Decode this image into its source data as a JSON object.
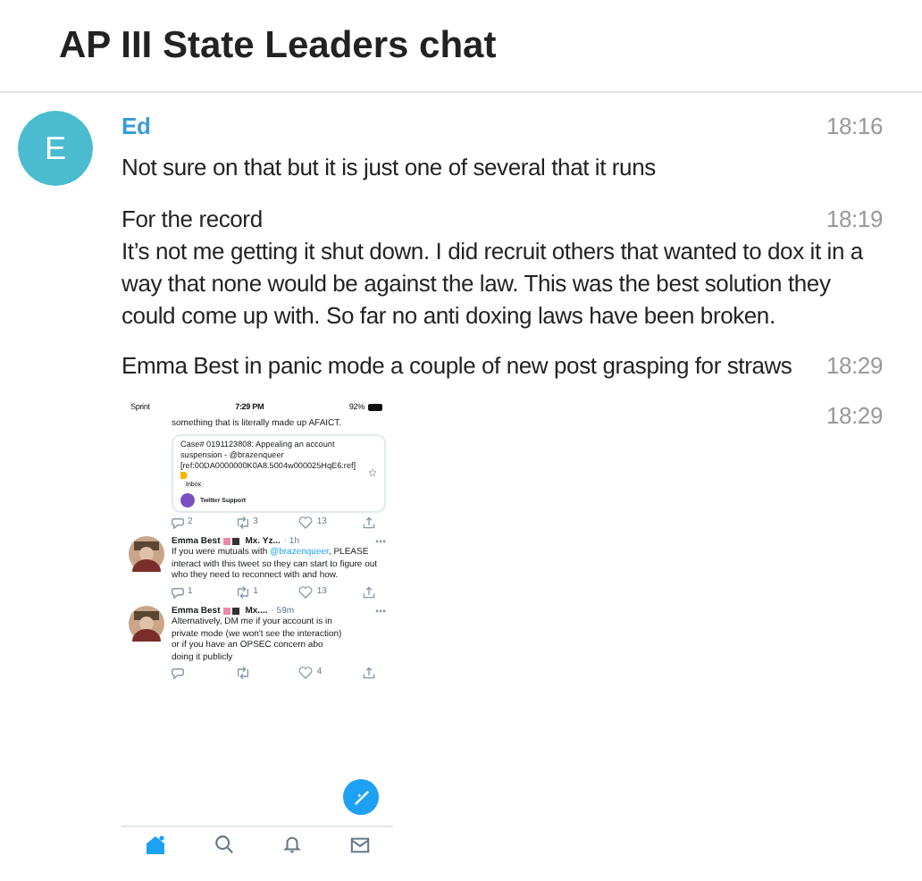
{
  "header": {
    "title": "AP III State Leaders chat"
  },
  "messages": [
    {
      "avatar": "E",
      "author": "Ed",
      "time": "18:16",
      "text": "Not sure on that but it is just one of several that it runs"
    },
    {
      "time": "18:19",
      "text": "For the record"
    },
    {
      "text": "It’s not me getting it shut down. I did recruit others that wanted to dox it in a way that none would be against the law. This was the best solution they could come up with. So far no anti doxing laws have been broken."
    },
    {
      "time": "18:29",
      "text": "Emma Best in panic mode a couple of new post grasping for straws"
    },
    {
      "time": "18:29",
      "kind": "screenshot",
      "screenshot": {
        "status_bar": {
          "carrier": "Sprint",
          "time": "7:29 PM",
          "battery": "92%"
        },
        "tweets": [
          {
            "kind": "partial",
            "text": "something that is literally made up AFAICT.",
            "quote": {
              "text": "Case# 0191123808: Appealing an account suspension - @brazenqueer [ref:00DA0000000K0A8.5004w000025HqE6:ref]",
              "tag": "Inbox",
              "author": "Twitter Support"
            },
            "replies": "2",
            "retweets": "3",
            "likes": "13"
          },
          {
            "kind": "tweet",
            "author": "Emma Best",
            "handle": "Mx. Yz...",
            "age": "· 1h",
            "text_before": "If you were mutuals with ",
            "mention": "@brazenqueer",
            "text_after": ", PLEASE interact with this tweet so they can start to figure out who they need to reconnect with and how.",
            "replies": "1",
            "retweets": "1",
            "likes": "13"
          },
          {
            "kind": "tweet",
            "author": "Emma Best",
            "handle": "Mx....",
            "age": "· 59m",
            "text_before": "Alternatively, DM me if your account is in private mode (we won't see the interaction) or if you have an OPSEC concern abo",
            "text_after2": "doing it publicly",
            "likes": "4"
          }
        ],
        "tabs": [
          {
            "kind": "home",
            "selected": true
          },
          {
            "kind": "search",
            "selected": false
          },
          {
            "kind": "bell",
            "selected": false
          },
          {
            "kind": "mail",
            "selected": false
          }
        ]
      }
    }
  ]
}
